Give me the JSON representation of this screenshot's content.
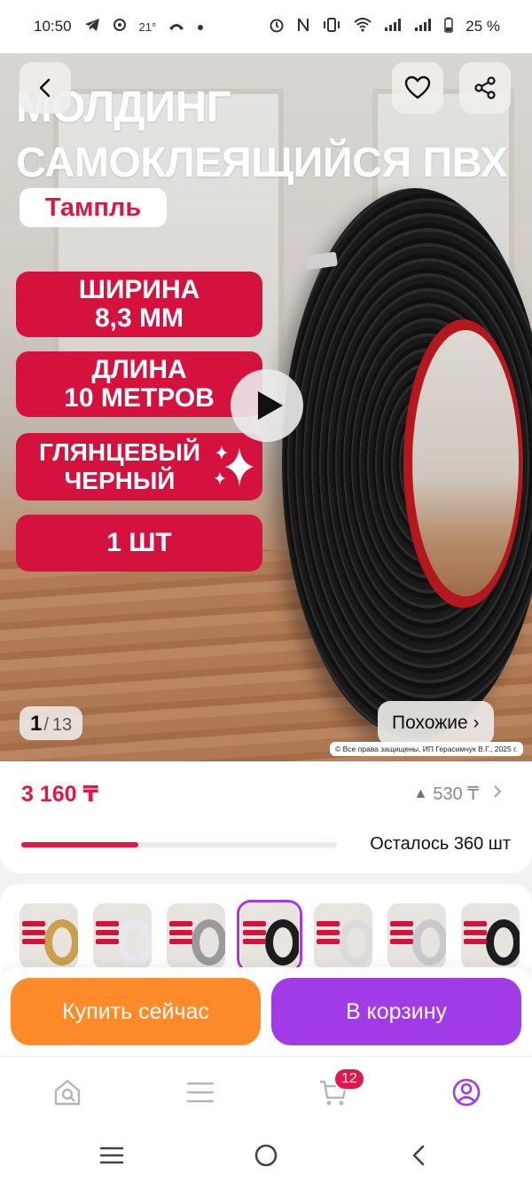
{
  "status_bar": {
    "time": "10:50",
    "temperature": "21°",
    "battery": "25 %"
  },
  "hero": {
    "title_line1": "МОЛДИНГ",
    "title_line2": "САМОКЛЕЯЩИЙСЯ ПВХ",
    "brand": "Тампль",
    "features": [
      {
        "line1": "ШИРИНА",
        "line2": "8,3 ММ"
      },
      {
        "line1": "ДЛИНА",
        "line2": "10 МЕТРОВ"
      },
      {
        "line1": "ГЛЯНЦЕВЫЙ",
        "line2": "ЧЕРНЫЙ"
      },
      {
        "line1": "1 ШТ",
        "line2": ""
      }
    ],
    "counter_current": "1",
    "counter_total": "13",
    "similar_label": "Похожие ›",
    "copyright": "© Все права защищены, ИП Герасимчук В.Г., 2025 г."
  },
  "price": {
    "value": "3 160 ₸",
    "bonus_value": "530 ₸",
    "stock_text": "Осталось 360 шт",
    "stock_fraction": 0.37
  },
  "variants": [
    {
      "color": "#c8a14a",
      "selected": false
    },
    {
      "color": "#e8e8ee",
      "selected": false
    },
    {
      "color": "#9a9a9a",
      "selected": false
    },
    {
      "color": "#1c1c1c",
      "selected": true
    },
    {
      "color": "#dcdcdc",
      "selected": false
    },
    {
      "color": "#c9c9cc",
      "selected": false
    },
    {
      "color": "#1c1c1c",
      "selected": false
    }
  ],
  "actions": {
    "buy_now": "Купить сейчас",
    "add_to_cart": "В корзину"
  },
  "bottom_nav": {
    "cart_badge": "12"
  },
  "colors": {
    "accent_red": "#e0184a",
    "buy_orange": "#ff8a2a",
    "cart_purple": "#a13be8"
  }
}
